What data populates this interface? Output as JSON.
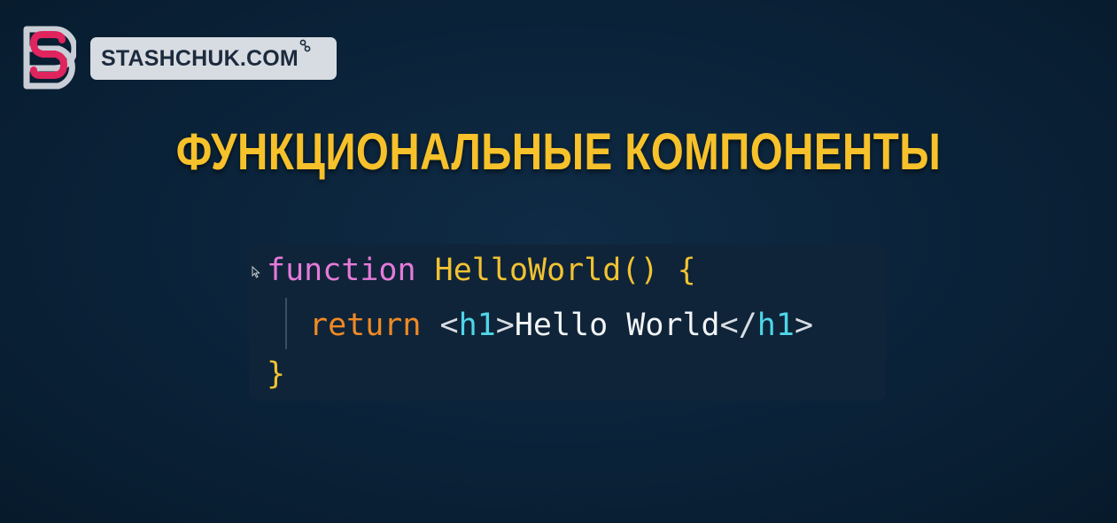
{
  "brand": {
    "logo_icon": "stashchuk-s-logo-icon",
    "site_name": "STASHCHUK.COM",
    "accent_color": "#e0245e",
    "badge_color": "#d7dce2"
  },
  "headline": {
    "text": "ФУНКЦИОНАЛЬНЫЕ КОМПОНЕНТЫ",
    "color": "#f6c12a"
  },
  "code": {
    "line1": {
      "keyword": "function",
      "name": "HelloWorld",
      "parens": "()",
      "open_brace": "{"
    },
    "line2": {
      "keyword": "return",
      "open_tag_lt": "<",
      "open_tag_name": "h1",
      "open_tag_gt": ">",
      "content": "Hello World",
      "close_tag_lt": "</",
      "close_tag_name": "h1",
      "close_tag_gt": ">"
    },
    "line3": {
      "close_brace": "}"
    },
    "cursor_icon": "mouse-pointer-icon"
  }
}
